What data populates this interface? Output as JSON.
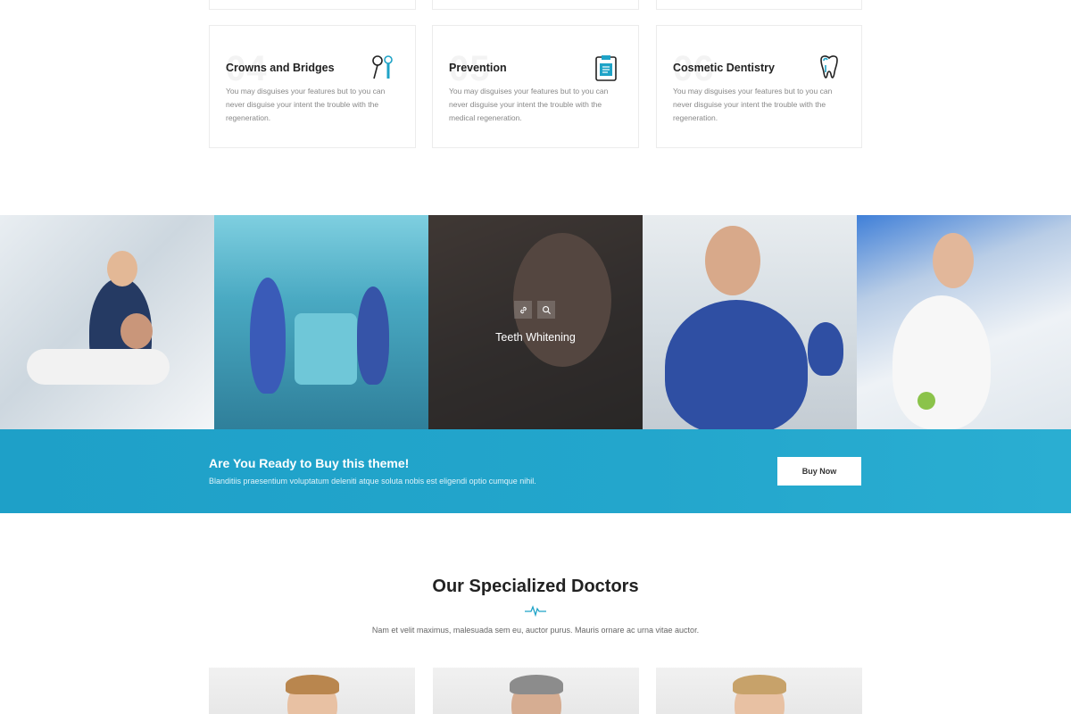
{
  "services": [
    {
      "number": "04",
      "title": "Crowns and Bridges",
      "icon": "dental-tools-icon",
      "description": "You may disguises your features but to you can never disguise your intent the trouble with the regeneration."
    },
    {
      "number": "05",
      "title": "Prevention",
      "icon": "clipboard-icon",
      "description": "You may disguises your features but to you can never disguise your intent the trouble with  the medical regeneration."
    },
    {
      "number": "06",
      "title": "Cosmetic Dentistry",
      "icon": "tooth-icon",
      "description": "You may disguises your features but to you can never disguise your intent the trouble with  the regeneration."
    }
  ],
  "gallery": {
    "hover_title": "Teeth Whitening",
    "link_icon": "link-icon",
    "zoom_icon": "search-icon"
  },
  "cta": {
    "title": "Are You Ready to Buy this theme!",
    "subtitle": "Blanditiis praesentium voluptatum deleniti atque soluta nobis est eligendi optio cumque nihil.",
    "button_label": "Buy Now"
  },
  "doctors": {
    "title": "Our Specialized Doctors",
    "subtitle": "Nam et velit maximus, malesuada sem eu, auctor purus. Mauris ornare ac urna vitae auctor."
  },
  "colors": {
    "accent": "#23a6cc",
    "icon_teal": "#1fa3c7"
  }
}
